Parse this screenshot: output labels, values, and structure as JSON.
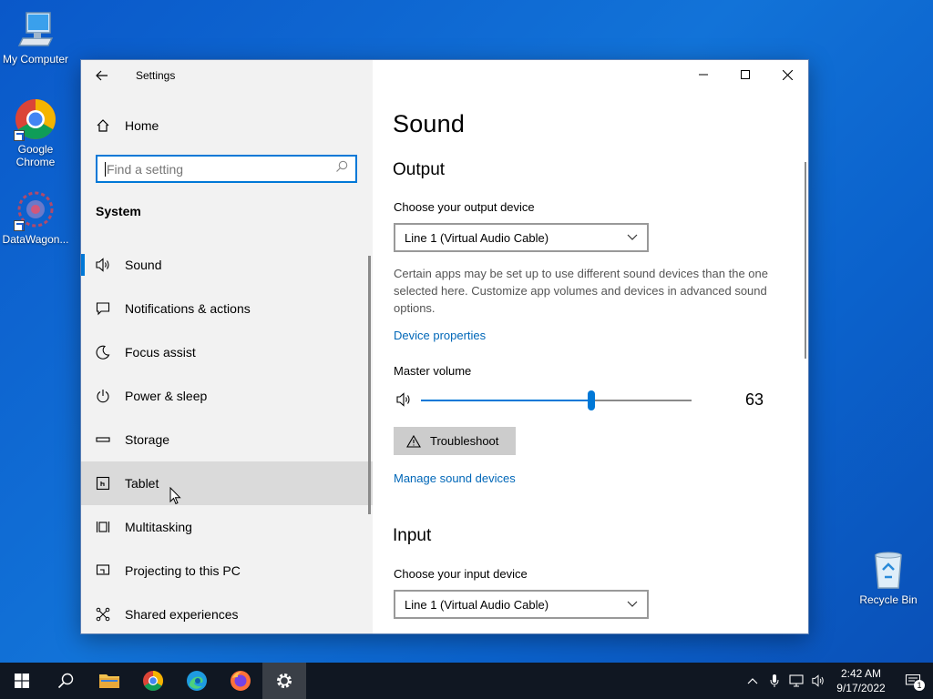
{
  "desktop": {
    "icons": [
      {
        "label": "My Computer"
      },
      {
        "label": "Google Chrome"
      },
      {
        "label": "DataWagon..."
      },
      {
        "label": "Recycle Bin"
      }
    ]
  },
  "window": {
    "title": "Settings",
    "home_label": "Home",
    "search": {
      "placeholder": "Find a setting",
      "value": ""
    },
    "section": "System",
    "nav_items": [
      {
        "label": "Sound",
        "icon": "speaker-icon",
        "active": true
      },
      {
        "label": "Notifications & actions",
        "icon": "notification-icon"
      },
      {
        "label": "Focus assist",
        "icon": "moon-icon"
      },
      {
        "label": "Power & sleep",
        "icon": "power-icon"
      },
      {
        "label": "Storage",
        "icon": "storage-icon"
      },
      {
        "label": "Tablet",
        "icon": "tablet-icon",
        "hover": true
      },
      {
        "label": "Multitasking",
        "icon": "multitasking-icon"
      },
      {
        "label": "Projecting to this PC",
        "icon": "projector-icon"
      },
      {
        "label": "Shared experiences",
        "icon": "shared-icon"
      }
    ]
  },
  "content": {
    "title": "Sound",
    "output": {
      "heading": "Output",
      "device_label": "Choose your output device",
      "device_value": "Line 1 (Virtual Audio Cable)",
      "description": "Certain apps may be set up to use different sound devices than the one selected here. Customize app volumes and devices in advanced sound options.",
      "device_properties_link": "Device properties",
      "volume_label": "Master volume",
      "volume_value": "63",
      "volume_fraction": 0.63,
      "troubleshoot_label": "Troubleshoot",
      "manage_link": "Manage sound devices"
    },
    "input": {
      "heading": "Input",
      "device_label": "Choose your input device",
      "device_value": "Line 1 (Virtual Audio Cable)"
    }
  },
  "taskbar": {
    "time": "2:42 AM",
    "date": "9/17/2022",
    "notification_count": "1"
  },
  "colors": {
    "accent": "#0078d7",
    "link": "#0067b8",
    "taskbar": "#101722"
  }
}
